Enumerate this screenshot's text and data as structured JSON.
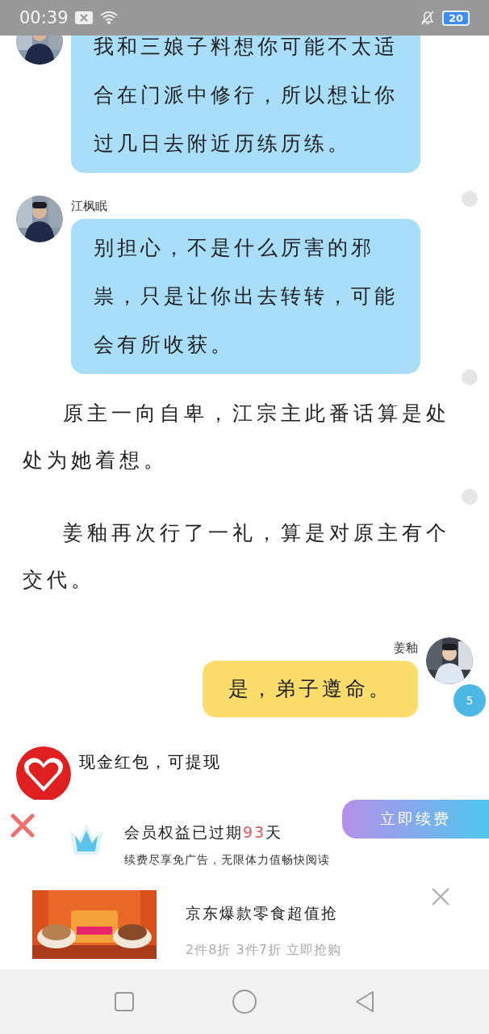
{
  "status_bar": {
    "time": "00:39",
    "battery": "20"
  },
  "messages": [
    {
      "kind": "left_bubble",
      "text": "我和三娘子料想你可能不太适合在门派中修行，所以想让你过几日去附近历练历练。"
    },
    {
      "kind": "left_bubble",
      "name": "江枫眠",
      "text": "别担心，不是什么厉害的邪祟，只是让你出去转转，可能会有所收获。",
      "comment_dot": true
    },
    {
      "kind": "narration",
      "text": "原主一向自卑，江宗主此番话算是处处为她着想。",
      "comment_dot": true
    },
    {
      "kind": "narration",
      "text": "姜釉再次行了一礼，算是对原主有个交代。",
      "comment_dot": true
    },
    {
      "kind": "right_bubble",
      "name": "姜釉",
      "text": "是，弟子遵命。",
      "comment_count": "5"
    },
    {
      "kind": "ad_message",
      "text": "现金红包，可提现"
    }
  ],
  "vip_banner": {
    "title": "会员权益已过期",
    "days": "93",
    "unit": "天",
    "subtitle": "续费尽享免广告，无限体力值畅快阅读",
    "button": "立即续费"
  },
  "ad": {
    "title": "京东爆款零食超值抢",
    "subtitle": "2件8折 3件7折 立即抢购"
  }
}
